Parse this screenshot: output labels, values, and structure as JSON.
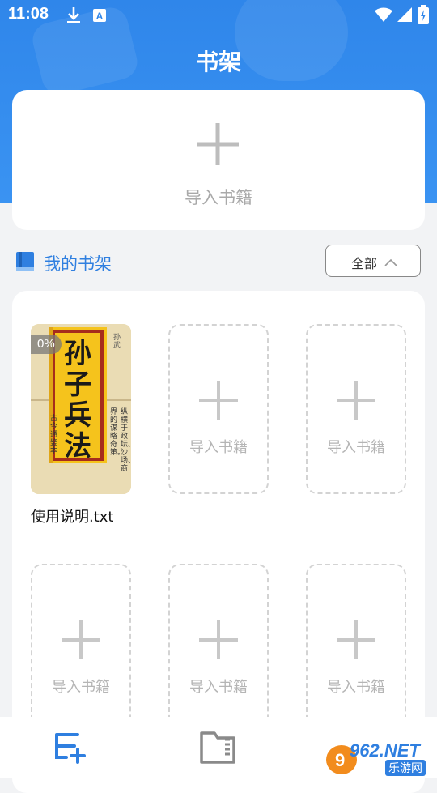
{
  "status_bar": {
    "time": "11:08",
    "icons": [
      "download-icon",
      "accessibility-a-icon",
      "wifi-icon",
      "signal-icon",
      "battery-charging-icon"
    ]
  },
  "header": {
    "title": "书架"
  },
  "import_card": {
    "label": "导入书籍",
    "icon": "plus-icon"
  },
  "my_shelf": {
    "title": "我的书架",
    "icon": "book-icon",
    "filter": {
      "label": "全部",
      "icon": "chevron-up-icon"
    }
  },
  "books": [
    {
      "title": "使用说明.txt",
      "progress": "0%",
      "cover": {
        "title_chars": [
          "孙",
          "子",
          "兵",
          "法"
        ],
        "side_text": "古今通鉴本",
        "top_right": "孙武",
        "page_lines": [
          "纵横于政坛、沙场、商",
          "界的谋略奇策。"
        ]
      }
    }
  ],
  "empty_slots": [
    {
      "label": "导入书籍"
    },
    {
      "label": "导入书籍"
    },
    {
      "label": "导入书籍"
    },
    {
      "label": "导入书籍"
    },
    {
      "label": "导入书籍"
    }
  ],
  "bottom_nav": [
    {
      "name": "bookshelf-tab",
      "icon": "bookshelf-add-icon",
      "active": true
    },
    {
      "name": "files-tab",
      "icon": "folder-icon",
      "active": false
    }
  ],
  "watermark": {
    "brand": "962.NET",
    "sub": "乐游网"
  },
  "colors": {
    "accent": "#2f7fe0",
    "header": "#3a93f2",
    "placeholder": "#b5b5b5"
  }
}
